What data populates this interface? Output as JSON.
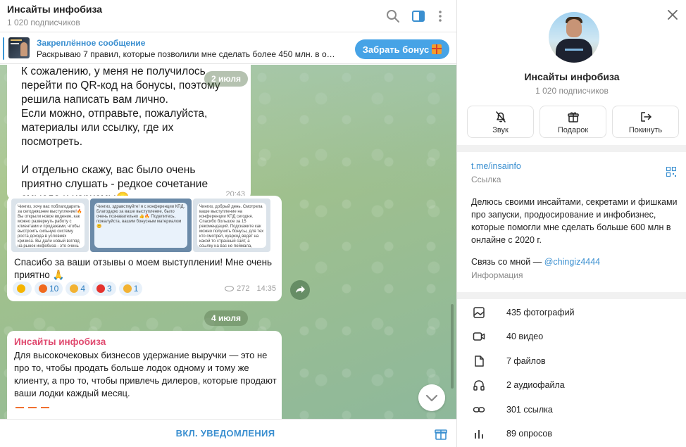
{
  "header": {
    "title": "Инсайты инфобиза",
    "subscribers": "1 020 подписчиков"
  },
  "pinned": {
    "title": "Закреплённое сообщение",
    "text": "Раскрываю 7 правил, которые позволили мне сделать более 450 млн. в онла...",
    "button": "Забрать бонус"
  },
  "messages": {
    "m1_text": "К сожалению, у меня не получилось\nперейти по QR-код на бонусы,  поэтому\nрешила написать вам лично.\nЕсли можно, отправьте, пожалуйста,\nматериалы или ссылку, где их\nпосмотреть.\n\nИ отдельно скажу, вас было очень\nприятно слушать - редкое сочетание\nсмысла и харизмы😊",
    "m1_time": "20:43",
    "date1": "2 июля",
    "shot1": "Чингиз, хочу вас поблагодарить за сегодняшнее выступление!🔥 Вы открыли новое видение, как можно развернуть работу с клиентами и продажами, чтобы выстроить сильную систему роста дохода в условиях кризиса. Вы дали новый взгляд на рынок инфобиза - это очень ценно!👏 Будем внедрять!",
    "shot2": "Чингиз, здравствуйте! я с конференции КПД. Благодарю за ваше выступление, было очень познавательно 👍🔥\n\nПоделитесь, пожалуйста, вашим бонусным материалом 😊",
    "shot3": "Чингиз, добрый день. Смотрела ваше выступление на конференции КПД сегодня. Спасибо большое за 15 рекомендаций. Подскажите как можно получить бонусы, для тех кто смотрел, куаркод ведет на какой то странный сайт, а ссылку на вас не поймала, позже смотрела уже. Буду благодарна!)",
    "m2_caption": "Спасибо за ваши отзывы о моем выступлении! Мне очень приятно 🙏",
    "reactions": [
      {
        "emoji": "star",
        "color": "#f5b400",
        "count": ""
      },
      {
        "emoji": "fire",
        "color": "#f06a1f",
        "count": "10"
      },
      {
        "emoji": "thumbs-up",
        "color": "#f2b233",
        "count": "4"
      },
      {
        "emoji": "heart",
        "color": "#e5322d",
        "count": "3"
      },
      {
        "emoji": "clap",
        "color": "#f2b233",
        "count": "1"
      }
    ],
    "m2_views": "272",
    "m2_time": "14:35",
    "date2": "4 июля",
    "m3_author": "Инсайты инфобиза",
    "m3_text": "Для высокочековых бизнесов удержание выручки — это не про то, чтобы продать больше лодок одному и тому же клиенту, а про то, чтобы привлечь дилеров, которые продают ваши лодки каждый месяц."
  },
  "bottom": {
    "notify": "ВКЛ. УВЕДОМЛЕНИЯ"
  },
  "profile": {
    "name": "Инсайты инфобиза",
    "subscribers": "1 020 подписчиков",
    "actions": [
      "Звук",
      "Подарок",
      "Покинуть"
    ],
    "link": "t.me/insainfo",
    "link_label": "Ссылка",
    "description": "Делюсь своими инсайтами, секретами и фишками про запуски, продюсирование и инфобизнес, которые помогли мне сделать больше 600 млн в онлайне с 2020 г.",
    "contact_prefix": "Связь со мной — ",
    "contact_handle": "@chingiz4444",
    "info_label": "Информация",
    "media": [
      {
        "icon": "photo-icon",
        "label": "435 фотографий"
      },
      {
        "icon": "video-icon",
        "label": "40 видео"
      },
      {
        "icon": "file-icon",
        "label": "7 файлов"
      },
      {
        "icon": "headphones-icon",
        "label": "2 аудиофайла"
      },
      {
        "icon": "link-icon",
        "label": "301 ссылка"
      },
      {
        "icon": "poll-icon",
        "label": "89 опросов"
      }
    ]
  },
  "colors": {
    "accent": "#3a8fd0",
    "button": "#46a3e6",
    "author": "#e04a6f"
  }
}
